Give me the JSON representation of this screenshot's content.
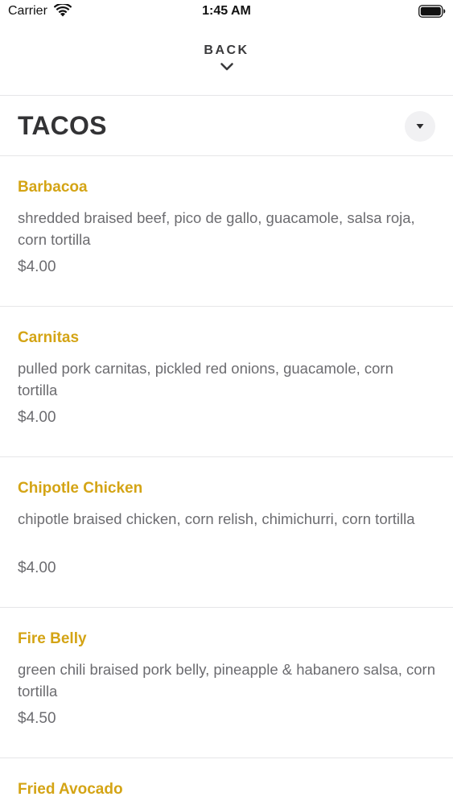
{
  "status_bar": {
    "carrier": "Carrier",
    "time": "1:45 AM",
    "icons": [
      "wifi-icon",
      "battery-icon"
    ]
  },
  "nav": {
    "back_label": "BACK",
    "back_icon": "chevron-down-icon"
  },
  "section": {
    "title": "TACOS",
    "toggle_icon": "caret-down-icon"
  },
  "colors": {
    "item_name": "#d4a415",
    "text_muted": "#6c6c70",
    "title": "#333335",
    "divider": "#e6e6e8"
  },
  "menu_items": [
    {
      "name": "Barbacoa",
      "description": "shredded braised beef, pico de gallo, guacamole, salsa roja, corn tortilla",
      "price": "$4.00"
    },
    {
      "name": "Carnitas",
      "description": "pulled pork carnitas, pickled red onions, guacamole, corn tortilla",
      "price": "$4.00"
    },
    {
      "name": "Chipotle Chicken",
      "description": "chipotle braised chicken, corn relish, chimichurri, corn tortilla",
      "price": "$4.00"
    },
    {
      "name": "Fire Belly",
      "description": "green chili braised pork belly, pineapple & habanero salsa, corn tortilla",
      "price": "$4.50"
    },
    {
      "name": "Fried Avocado"
    }
  ]
}
